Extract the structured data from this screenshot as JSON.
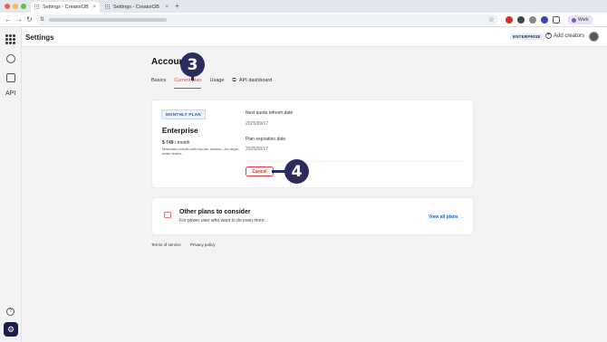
{
  "browser": {
    "tabs": [
      {
        "label": "Settings - CreatorDB"
      },
      {
        "label": "Settings - CreatorDB"
      }
    ],
    "new_tab": "+",
    "profile_label": "Work"
  },
  "app": {
    "header_title": "Settings",
    "plan_badge": "ENTERPRISE",
    "add_creators": "Add creators",
    "sidebar_label": "API"
  },
  "page": {
    "title": "Account",
    "tabs": [
      {
        "label": "Basics"
      },
      {
        "label": "Current plan"
      },
      {
        "label": "Usage"
      },
      {
        "label": "API dashboard"
      }
    ]
  },
  "plan_card": {
    "badge": "MONTHLY PLAN",
    "name": "Enterprise",
    "price": "$ 749",
    "period": " / month",
    "description": "Maximize results with top-tier access—for large-scale teams.",
    "refresh_label": "Next quota refresh date",
    "refresh_date": "2025/09/17",
    "expiration_label": "Plan expiration date",
    "expiration_date": "2025/09/17",
    "cancel_label": "Cancel"
  },
  "other_plans": {
    "heading": "Other plans to consider",
    "subtext": "For power user who want to do even more.",
    "link": "View all plans →"
  },
  "footer": {
    "terms": "Terms of service",
    "privacy": "Privacy policy"
  },
  "annotations": {
    "step_tab": "3",
    "step_cancel": "4"
  },
  "colors": {
    "accent": "#e53935",
    "annotation": "#2b2d5e",
    "link": "#1565c0"
  }
}
